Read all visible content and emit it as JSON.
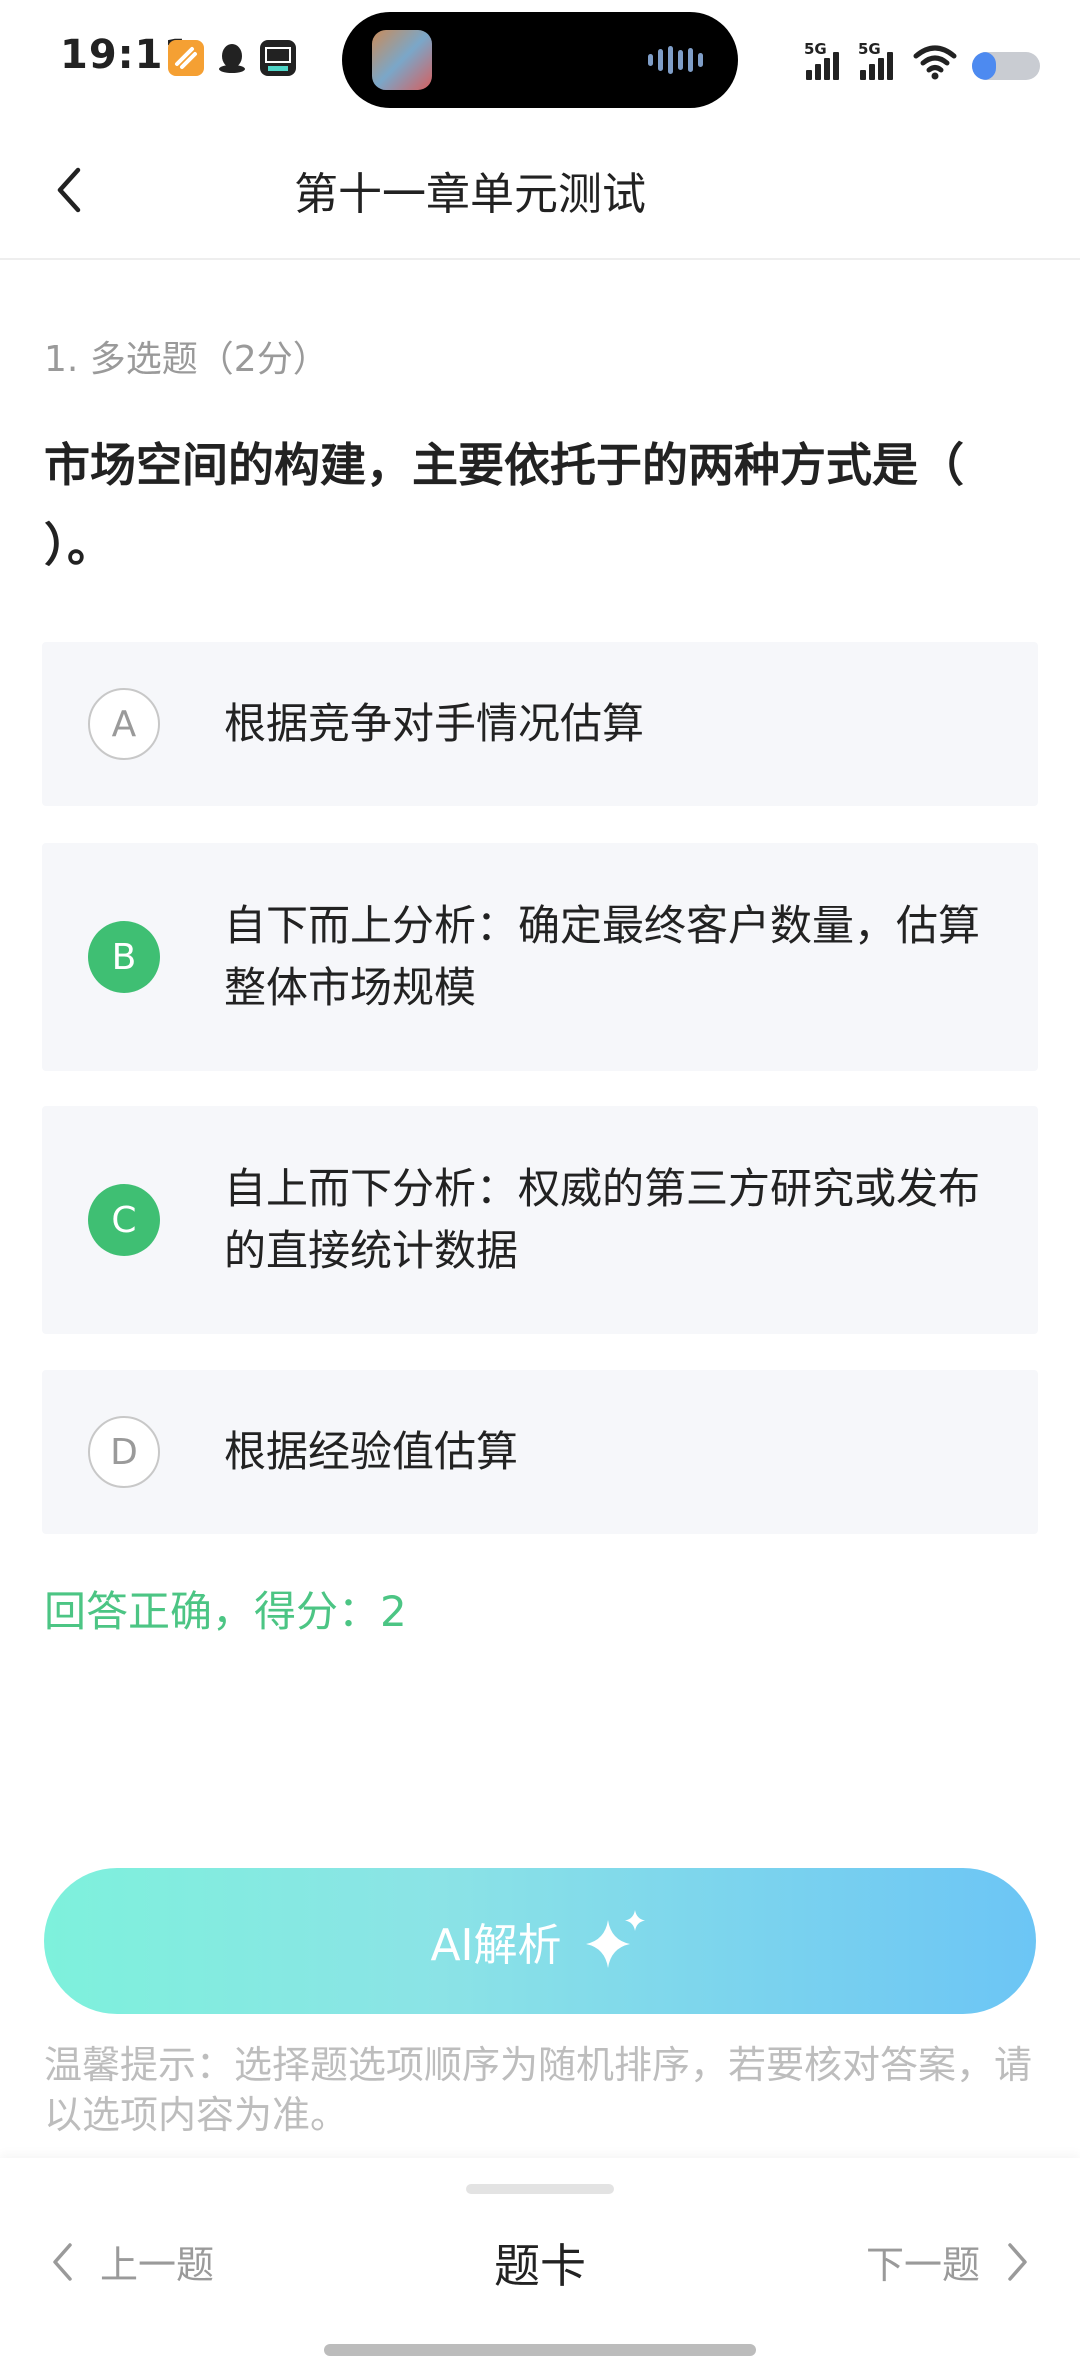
{
  "status": {
    "time": "19:11",
    "signal1": "5G",
    "signal2": "5G",
    "battery_level": 0.35
  },
  "nav": {
    "title": "第十一章单元测试"
  },
  "question": {
    "meta": "1. 多选题（2分）",
    "text": "市场空间的构建，主要依托于的两种方式是（ ）。",
    "options": [
      {
        "letter": "A",
        "text": "根据竞争对手情况估算",
        "selected": false
      },
      {
        "letter": "B",
        "text": "自下而上分析：确定最终客户数量，估算整体市场规模",
        "selected": true
      },
      {
        "letter": "C",
        "text": "自上而下分析：权威的第三方研究或发布的直接统计数据",
        "selected": true
      },
      {
        "letter": "D",
        "text": "根据经验值估算",
        "selected": false
      }
    ]
  },
  "result": "回答正确，得分：2",
  "ai_button": {
    "label": "AI解析"
  },
  "hint": "温馨提示：选择题选项顺序为随机排序，若要核对答案，请以选项内容为准。",
  "bottom_nav": {
    "prev_label": "上一题",
    "card_label": "题卡",
    "next_label": "下一题"
  },
  "colors": {
    "correct_green": "#3fbf73",
    "result_green": "#4cc584",
    "option_bg": "#f6f7fa"
  }
}
